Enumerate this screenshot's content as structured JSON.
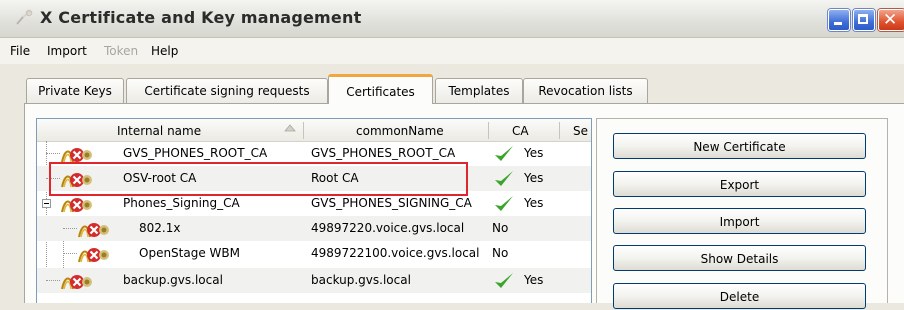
{
  "window": {
    "title": "X Certificate and Key management"
  },
  "menu": {
    "items": [
      {
        "label": "File",
        "enabled": true
      },
      {
        "label": "Import",
        "enabled": true
      },
      {
        "label": "Token",
        "enabled": false
      },
      {
        "label": "Help",
        "enabled": true
      }
    ]
  },
  "tabs": [
    {
      "label": "Private Keys",
      "active": false
    },
    {
      "label": "Certificate signing requests",
      "active": false
    },
    {
      "label": "Certificates",
      "active": true
    },
    {
      "label": "Templates",
      "active": false
    },
    {
      "label": "Revocation lists",
      "active": false
    }
  ],
  "table": {
    "columns": [
      "Internal name",
      "commonName",
      "CA",
      "Se"
    ],
    "sort_indicator": "sort-ascending-icon",
    "rows": [
      {
        "internal_name": "GVS_PHONES_ROOT_CA",
        "common_name": "GVS_PHONES_ROOT_CA",
        "ca": "Yes",
        "ca_check": true
      },
      {
        "internal_name": "OSV-root CA",
        "common_name": "Root CA",
        "ca": "Yes",
        "ca_check": true
      },
      {
        "internal_name": "Phones_Signing_CA",
        "common_name": "GVS_PHONES_SIGNING_CA",
        "ca": "Yes",
        "ca_check": true
      },
      {
        "internal_name": "802.1x",
        "common_name": "49897220.voice.gvs.local",
        "ca": "No",
        "ca_check": false
      },
      {
        "internal_name": "OpenStage WBM",
        "common_name": "4989722100.voice.gvs.local",
        "ca": "No",
        "ca_check": false
      },
      {
        "internal_name": "backup.gvs.local",
        "common_name": "backup.gvs.local",
        "ca": "Yes",
        "ca_check": true
      }
    ]
  },
  "buttons": {
    "new_certificate": "New Certificate",
    "export": "Export",
    "import": "Import",
    "show_details": "Show Details",
    "delete": "Delete"
  },
  "colors": {
    "highlight": "#e0252d",
    "check": "#3aa52a",
    "active_tab_accent": "#f2a640"
  }
}
